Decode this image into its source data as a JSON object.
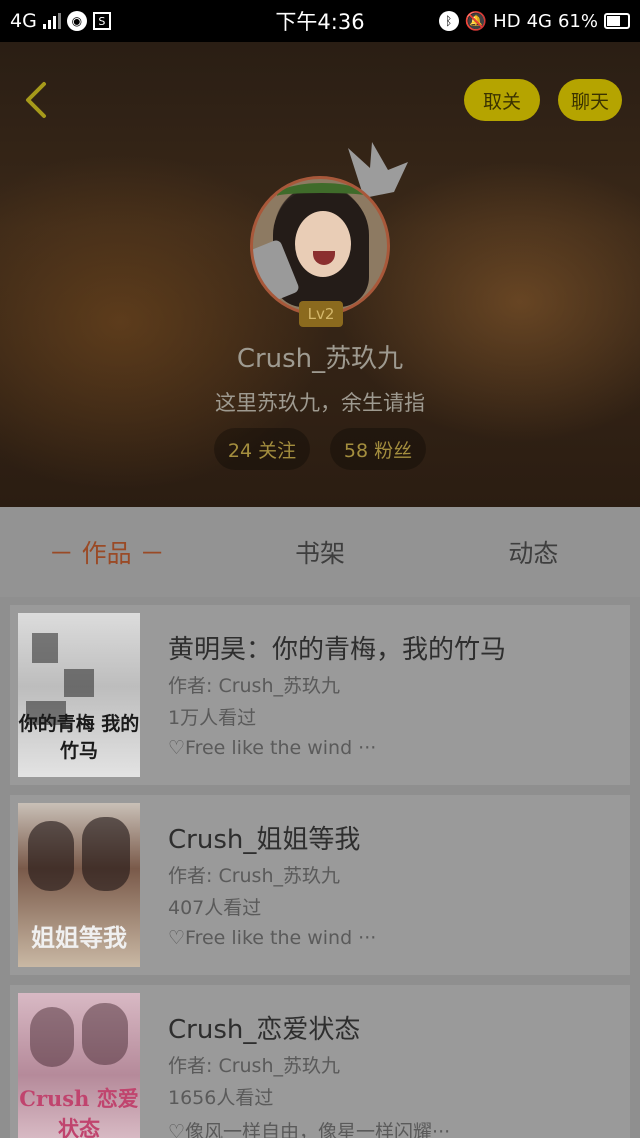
{
  "status_bar": {
    "network_left": "4G",
    "time": "下午4:36",
    "hd": "HD",
    "network_right": "4G",
    "battery": "61%"
  },
  "header": {
    "unfollow_label": "取关",
    "chat_label": "聊天",
    "level": "Lv2",
    "username": "Crush_苏玖九",
    "bio": "这里苏玖九，余生请指",
    "following": "24 关注",
    "fans": "58 粉丝"
  },
  "tabs": [
    {
      "label": "－ 作品 －",
      "active": true
    },
    {
      "label": "书架",
      "active": false
    },
    {
      "label": "动态",
      "active": false
    }
  ],
  "works": [
    {
      "title": "黄明昊：你的青梅，我的竹马",
      "author": "作者: Crush_苏玖九",
      "views": "1万人看过",
      "desc": "♡Free like the wind ···",
      "cover_text": "你的青梅 我的竹马"
    },
    {
      "title": "Crush_姐姐等我",
      "author": "作者: Crush_苏玖九",
      "views": "407人看过",
      "desc": "♡Free like the wind ···",
      "cover_text": "姐姐等我"
    },
    {
      "title": "Crush_恋爱状态",
      "author": "作者: Crush_苏玖九",
      "views": "1656人看过",
      "desc": "♡像风一样自由，像星一样闪耀···",
      "cover_text": "Crush 恋爱状态"
    }
  ],
  "colors": {
    "accent_tab": "#9a4a26",
    "pill_button": "#b5a400",
    "stat_text": "#a48e3e"
  },
  "icons": [
    "back-arrow-icon",
    "crown-icon",
    "signal-icon",
    "battery-icon"
  ]
}
